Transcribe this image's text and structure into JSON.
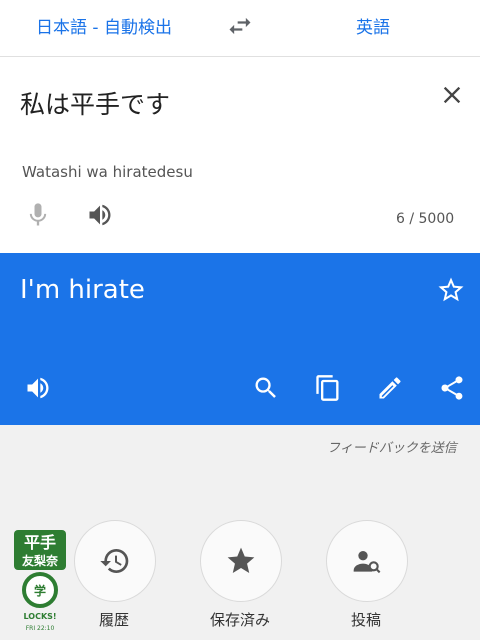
{
  "header": {
    "source_language": "日本語 - 自動検出",
    "target_language": "英語"
  },
  "input": {
    "text": "私は平手です",
    "transliteration": "Watashi wa hiratedesu",
    "char_count": "6 / 5000"
  },
  "result": {
    "text": "I'm hirate"
  },
  "feedback_link": "フィードバックを送信",
  "actions": [
    {
      "label": "履歴",
      "icon": "history-icon"
    },
    {
      "label": "保存済み",
      "icon": "star-icon"
    },
    {
      "label": "投稿",
      "icon": "community-icon"
    }
  ],
  "stamp": {
    "line1": "平手",
    "line2": "友梨奈",
    "line3": "LOCKS!",
    "line4": "FRI 22:10"
  },
  "colors": {
    "accent": "#1a73e8",
    "result_bg": "#1b74e8"
  }
}
